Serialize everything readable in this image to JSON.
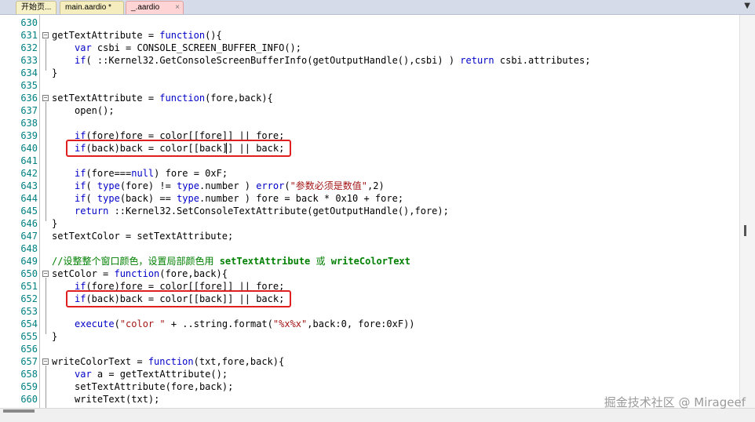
{
  "tabs": [
    {
      "label": "开始页..."
    },
    {
      "label": "main.aardio *"
    },
    {
      "label": "_.aardio",
      "close": "×"
    }
  ],
  "tab_menu_icon": "chevron-down-icon",
  "tab_menu_glyph": "▼",
  "watermark": "掘金技术社区 @ Mirageef",
  "lines": {
    "l630": {
      "n": "630"
    },
    "l631": {
      "n": "631",
      "a": "getTextAttribute = ",
      "b": "function",
      "c": "(){"
    },
    "l632": {
      "n": "632",
      "a": "var",
      "b": " csbi = CONSOLE_SCREEN_BUFFER_INFO();"
    },
    "l633": {
      "n": "633",
      "a": "if",
      "b": "( ::Kernel32.GetConsoleScreenBufferInfo(getOutputHandle(),csbi) ) ",
      "c": "return",
      "d": " csbi.attributes;"
    },
    "l634": {
      "n": "634",
      "a": "}"
    },
    "l635": {
      "n": "635"
    },
    "l636": {
      "n": "636",
      "a": "setTextAttribute = ",
      "b": "function",
      "c": "(fore,back){"
    },
    "l637": {
      "n": "637",
      "a": "open();"
    },
    "l638": {
      "n": "638"
    },
    "l639": {
      "n": "639",
      "a": "if",
      "b": "(fore)fore = color[[fore]] || fore;"
    },
    "l640": {
      "n": "640",
      "a": "if",
      "b": "(back)back = color[[back]] || back;"
    },
    "l641": {
      "n": "641"
    },
    "l642": {
      "n": "642",
      "a": "if",
      "b": "(fore===",
      "c": "null",
      "d": ") fore = 0xF;"
    },
    "l643": {
      "n": "643",
      "a": "if",
      "b": "( ",
      "c": "type",
      "d": "(fore) != ",
      "e": "type",
      "f": ".number ) ",
      "g": "error",
      "h": "(",
      "i": "\"参数必须是数值\"",
      "j": ",2)"
    },
    "l644": {
      "n": "644",
      "a": "if",
      "b": "( ",
      "c": "type",
      "d": "(back) == ",
      "e": "type",
      "f": ".number ) fore = back * 0x10 + fore;"
    },
    "l645": {
      "n": "645",
      "a": "return",
      "b": " ::Kernel32.SetConsoleTextAttribute(getOutputHandle(),fore);"
    },
    "l646": {
      "n": "646",
      "a": "}"
    },
    "l647": {
      "n": "647",
      "a": "setTextColor = setTextAttribute;"
    },
    "l648": {
      "n": "648"
    },
    "l649": {
      "n": "649",
      "a": "//设整整个窗口颜色，设置局部颜色用 ",
      "b": "setTextAttribute",
      "c": " 或 ",
      "d": "writeColorText"
    },
    "l650": {
      "n": "650",
      "a": "setColor = ",
      "b": "function",
      "c": "(fore,back){"
    },
    "l651": {
      "n": "651",
      "a": "if",
      "b": "(fore)fore = color[[fore]] || fore;"
    },
    "l652": {
      "n": "652",
      "a": "if",
      "b": "(back)back = color[[back]] || back;"
    },
    "l653": {
      "n": "653"
    },
    "l654": {
      "n": "654",
      "a": "execute",
      "b": "(",
      "c": "\"color \"",
      "d": " + ..string.format(",
      "e": "\"%x%x\"",
      "f": ",back:0, fore:0xF))"
    },
    "l655": {
      "n": "655",
      "a": "}"
    },
    "l656": {
      "n": "656"
    },
    "l657": {
      "n": "657",
      "a": "writeColorText = ",
      "b": "function",
      "c": "(txt,fore,back){"
    },
    "l658": {
      "n": "658",
      "a": "var",
      "b": " a = getTextAttribute();"
    },
    "l659": {
      "n": "659",
      "a": "setTextAttribute(fore,back);"
    },
    "l660": {
      "n": "660",
      "a": "writeText(txt);"
    }
  }
}
